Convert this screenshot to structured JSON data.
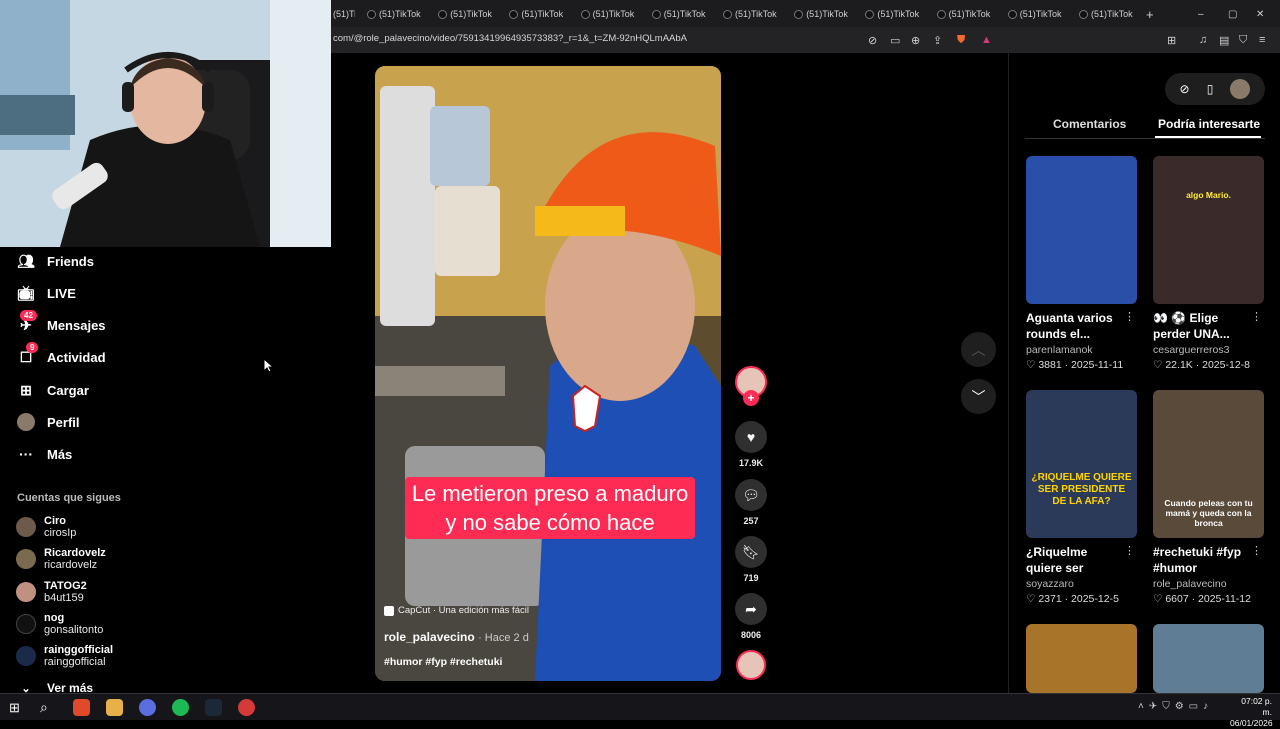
{
  "browser": {
    "tab_title": "(51)TikTok",
    "tab_count": 12,
    "new_tab_symbol": "+",
    "url": "com/@role_palavecino/video/7591341996493573383?_r=1&_t=ZM-92nHQLmAAbA"
  },
  "sidebar": {
    "items": [
      {
        "label": "Friends",
        "icon": "friends-icon",
        "badge": ""
      },
      {
        "label": "LIVE",
        "icon": "live-icon",
        "badge": ""
      },
      {
        "label": "Mensajes",
        "icon": "messages-icon",
        "badge": "42"
      },
      {
        "label": "Actividad",
        "icon": "activity-icon",
        "badge": "9"
      },
      {
        "label": "Cargar",
        "icon": "upload-icon",
        "badge": ""
      },
      {
        "label": "Perfil",
        "icon": "profile-avatar",
        "badge": ""
      },
      {
        "label": "Más",
        "icon": "more-icon",
        "badge": ""
      }
    ],
    "following_title": "Cuentas que sigues",
    "following": [
      {
        "name": "Ciro",
        "handle": "cirosIp"
      },
      {
        "name": "Ricardovelz",
        "handle": "ricardovelz"
      },
      {
        "name": "TATOG2",
        "handle": "b4ut159"
      },
      {
        "name": "nog",
        "handle": "gonsalitonto"
      },
      {
        "name": "rainggofficial",
        "handle": "rainggofficial"
      }
    ],
    "see_more": "Ver más"
  },
  "video": {
    "caption": "Le metieron preso a maduro y no sabe cómo hace",
    "capcut": "CapCut · Una edición más fácil",
    "author": "role_palavecino",
    "time": "· Hace 2 d",
    "hashtags": "#humor #fyp #rechetuki"
  },
  "actions": {
    "likes": "17.9K",
    "comments": "257",
    "saves": "719",
    "shares": "8006"
  },
  "panel": {
    "tab_comments": "Comentarios",
    "tab_suggested": "Podría interesarte",
    "cards": [
      {
        "title": "Aguanta varios rounds el...",
        "user": "parenlamanok",
        "likes": "3881",
        "date": "2025-11-11",
        "thumb_color": "#2a4fa8"
      },
      {
        "title": "👀 ⚽ Elige perder UNA...",
        "user": "cesarguerreros3",
        "likes": "22.1K",
        "date": "2025-12-8",
        "thumb_color": "#3a2a2a",
        "overlay": "algo Mario."
      },
      {
        "title": "¿Riquelme quiere ser presidente d...",
        "user": "soyazzaro",
        "likes": "2371",
        "date": "2025-12-5",
        "thumb_color": "#2c3a5a",
        "overlay": "¿RIQUELME QUIERE SER PRESIDENTE DE LA AFA?"
      },
      {
        "title": "#rechetuki #fyp #humor",
        "user": "role_palavecino",
        "likes": "6607",
        "date": "2025-11-12",
        "thumb_color": "#5a4a3a",
        "overlay": "Cuando peleas con tu mamá y queda con la bronca"
      },
      {
        "title": "",
        "user": "",
        "likes": "",
        "date": "",
        "thumb_color": "#a8742a"
      },
      {
        "title": "",
        "user": "",
        "likes": "",
        "date": "",
        "thumb_color": "#5f7d95"
      }
    ]
  },
  "taskbar": {
    "time": "07:02 p. m.",
    "date": "06/01/2026"
  }
}
